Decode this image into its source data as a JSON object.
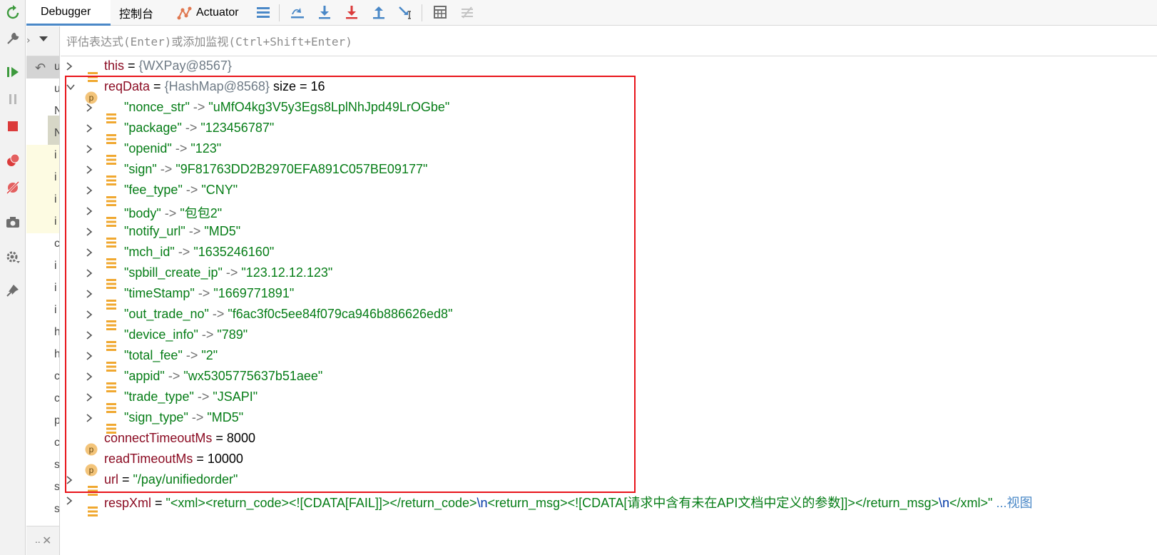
{
  "tabs": {
    "debugger": "Debugger",
    "console": "控制台",
    "actuator": "Actuator"
  },
  "frames": {
    "letters": [
      "u",
      "u",
      "N",
      "N",
      "i",
      "i",
      "i",
      "i",
      "c",
      "i",
      "i",
      "i",
      "h",
      "h",
      "c",
      "c",
      "p",
      "c",
      "s",
      "s",
      "s"
    ],
    "bottom_dots": ".."
  },
  "evaluate": {
    "placeholder": "评估表达式(Enter)或添加监视(Ctrl+Shift+Enter)"
  },
  "variables": {
    "this": {
      "name": "this",
      "eq": " = ",
      "value": "{WXPay@8567}"
    },
    "reqData": {
      "name": "reqData",
      "eq": " = ",
      "value": "{HashMap@8568}",
      "size": "size = 16"
    },
    "entries": [
      {
        "key": "\"nonce_str\"",
        "value": "\"uMfO4kg3V5y3Egs8LplNhJpd49LrOGbe\""
      },
      {
        "key": "\"package\"",
        "value": "\"123456787\""
      },
      {
        "key": "\"openid\"",
        "value": "\"123\""
      },
      {
        "key": "\"sign\"",
        "value": "\"9F81763DD2B2970EFA891C057BE09177\""
      },
      {
        "key": "\"fee_type\"",
        "value": "\"CNY\""
      },
      {
        "key": "\"body\"",
        "value": "\"包包2\""
      },
      {
        "key": "\"notify_url\"",
        "value": "\"MD5\""
      },
      {
        "key": "\"mch_id\"",
        "value": "\"1635246160\""
      },
      {
        "key": "\"spbill_create_ip\"",
        "value": "\"123.12.12.123\""
      },
      {
        "key": "\"timeStamp\"",
        "value": "\"1669771891\""
      },
      {
        "key": "\"out_trade_no\"",
        "value": "\"f6ac3f0c5ee84f079ca946b886626ed8\""
      },
      {
        "key": "\"device_info\"",
        "value": "\"789\""
      },
      {
        "key": "\"total_fee\"",
        "value": "\"2\""
      },
      {
        "key": "\"appid\"",
        "value": "\"wx5305775637b51aee\""
      },
      {
        "key": "\"trade_type\"",
        "value": "\"JSAPI\""
      },
      {
        "key": "\"sign_type\"",
        "value": "\"MD5\""
      }
    ],
    "arrow": " -> ",
    "connectTimeoutMs": {
      "name": "connectTimeoutMs",
      "eq": " = ",
      "value": "8000"
    },
    "readTimeoutMs": {
      "name": "readTimeoutMs",
      "eq": " = ",
      "value": "10000"
    },
    "url": {
      "name": "url",
      "eq": " = ",
      "value": "\"/pay/unifiedorder\""
    },
    "respXml": {
      "name": "respXml",
      "eq": " = ",
      "part1": "\"<xml><return_code><![CDATA[FAIL]]></return_code>",
      "esc1": "\\n",
      "part2": "<return_msg><![CDATA[请求中含有未在API文档中定义的参数]]></return_msg>",
      "esc2": "\\n",
      "part3": "</xml>\"",
      "view": " ...视图"
    }
  },
  "badges": {
    "protected": "p"
  },
  "colors": {
    "accent": "#4a88c7",
    "highlight_border": "#e8141a",
    "string_value": "#067d17",
    "field_name": "#8b0c23"
  }
}
